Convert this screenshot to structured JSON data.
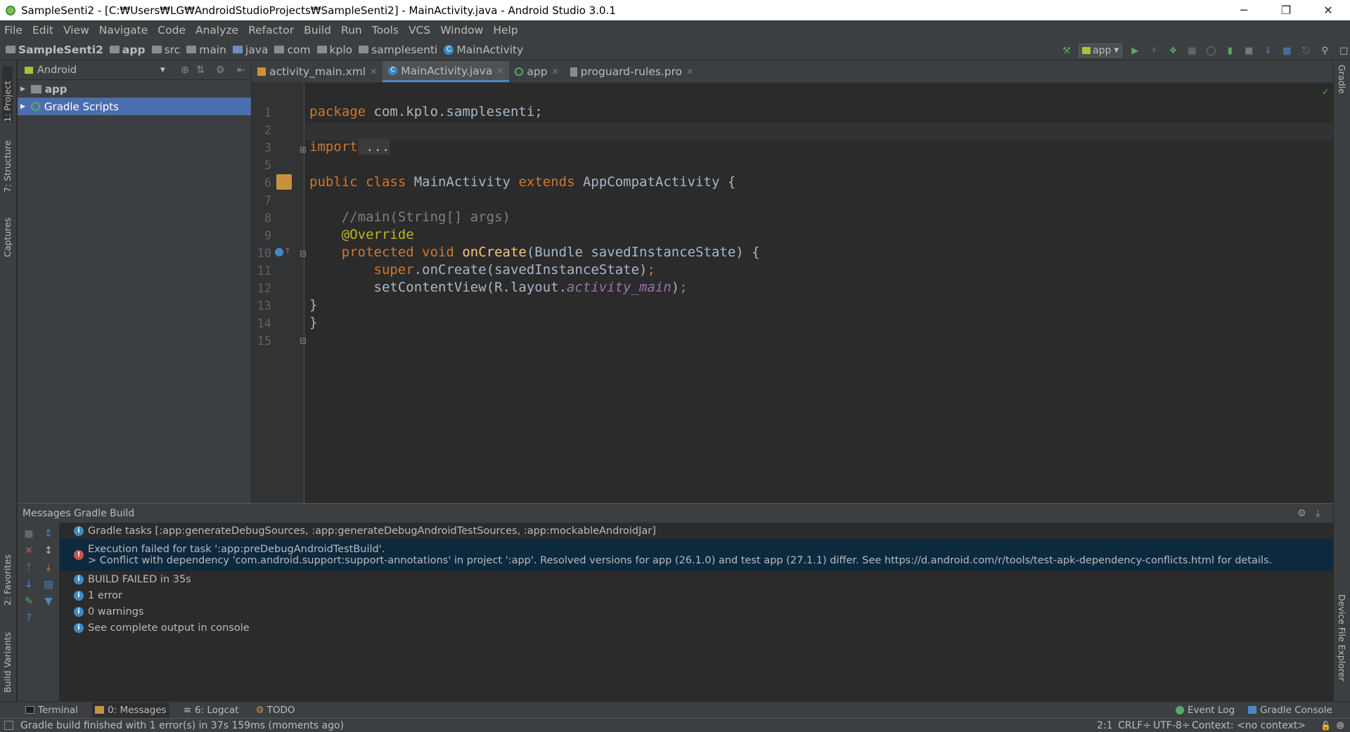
{
  "window": {
    "title": "SampleSenti2 - [C:₩Users₩LG₩AndroidStudioProjects₩SampleSenti2] - MainActivity.java - Android Studio 3.0.1",
    "controls": {
      "minimize": "─",
      "restore": "❐",
      "close": "✕"
    }
  },
  "menu": [
    "File",
    "Edit",
    "View",
    "Navigate",
    "Code",
    "Analyze",
    "Refactor",
    "Build",
    "Run",
    "Tools",
    "VCS",
    "Window",
    "Help"
  ],
  "breadcrumbs": [
    "SampleSenti2",
    "app",
    "src",
    "main",
    "java",
    "com",
    "kplo",
    "samplesenti",
    "MainActivity"
  ],
  "toolbar": {
    "run_config": "app"
  },
  "left_stripe": {
    "project": "1: Project",
    "structure": "7: Structure",
    "captures": "Captures",
    "favorites": "2: Favorites",
    "build_variants": "Build Variants"
  },
  "right_stripe": {
    "gradle": "Gradle",
    "device_explorer": "Device File Explorer"
  },
  "project_panel": {
    "view_mode": "Android",
    "items": [
      {
        "label": "app",
        "selected": false
      },
      {
        "label": "Gradle Scripts",
        "selected": true
      }
    ]
  },
  "editor_tabs": [
    {
      "label": "activity_main.xml",
      "active": false
    },
    {
      "label": "MainActivity.java",
      "active": true
    },
    {
      "label": "app",
      "active": false
    },
    {
      "label": "proguard-rules.pro",
      "active": false
    }
  ],
  "code": {
    "line_numbers": [
      "1",
      "2",
      "3",
      "5",
      "6",
      "7",
      "8",
      "9",
      "10",
      "11",
      "12",
      "13",
      "14",
      "15"
    ],
    "l1_kw": "package",
    "l1_rest": " com.kplo.samplesenti;",
    "l3_kw": "import",
    "l3_fold": " ...",
    "l6_kw1": "public class",
    "l6_name": " MainActivity ",
    "l6_kw2": "extends",
    "l6_rest": " AppCompatActivity {",
    "l8_comment": "    //main(String[] args)",
    "l9_ann": "    @Override",
    "l10_kw": "    protected void",
    "l10_fn": " onCreate",
    "l10_rest": "(Bundle savedInstanceState) {",
    "l11_kw": "        super",
    "l11_rest": ".onCreate(savedInstanceState)",
    "l11_semi": ";",
    "l12_pre": "        setContentView(R.layout.",
    "l12_it": "activity_main",
    "l12_post": ")",
    "l12_semi": ";",
    "l13": "}",
    "l14": "}"
  },
  "messages": {
    "header": "Messages Gradle Build",
    "rows": [
      {
        "kind": "info",
        "text": "Gradle tasks [:app:generateDebugSources, :app:generateDebugAndroidTestSources, :app:mockableAndroidJar]"
      },
      {
        "kind": "error",
        "text": "Execution failed for task ':app:preDebugAndroidTestBuild'.",
        "detail": "> Conflict with dependency 'com.android.support:support-annotations' in project ':app'. Resolved versions for app (26.1.0) and test app (27.1.1) differ. See https://d.android.com/r/tools/test-apk-dependency-conflicts.html for details."
      },
      {
        "kind": "info",
        "text": "BUILD FAILED in 35s"
      },
      {
        "kind": "info",
        "text": "1 error"
      },
      {
        "kind": "info",
        "text": "0 warnings"
      },
      {
        "kind": "info",
        "text": "See complete output in console"
      }
    ]
  },
  "bottom_tabs": [
    {
      "label": "Terminal",
      "selected": false
    },
    {
      "label": "0: Messages",
      "selected": true
    },
    {
      "label": "6: Logcat",
      "selected": false
    },
    {
      "label": "TODO",
      "selected": false
    }
  ],
  "bottom_right_tabs": [
    "Event Log",
    "Gradle Console"
  ],
  "status": {
    "message": "Gradle build finished with 1 error(s) in 37s 159ms (moments ago)",
    "position": "2:1",
    "line_sep": "CRLF÷",
    "encoding": "UTF-8÷",
    "context": "Context: <no context>"
  },
  "colors": {
    "accent": "#4a88c7",
    "selection": "#4b6eaf",
    "error": "#c75450",
    "info": "#3d8ac4",
    "run_green": "#59a869"
  }
}
